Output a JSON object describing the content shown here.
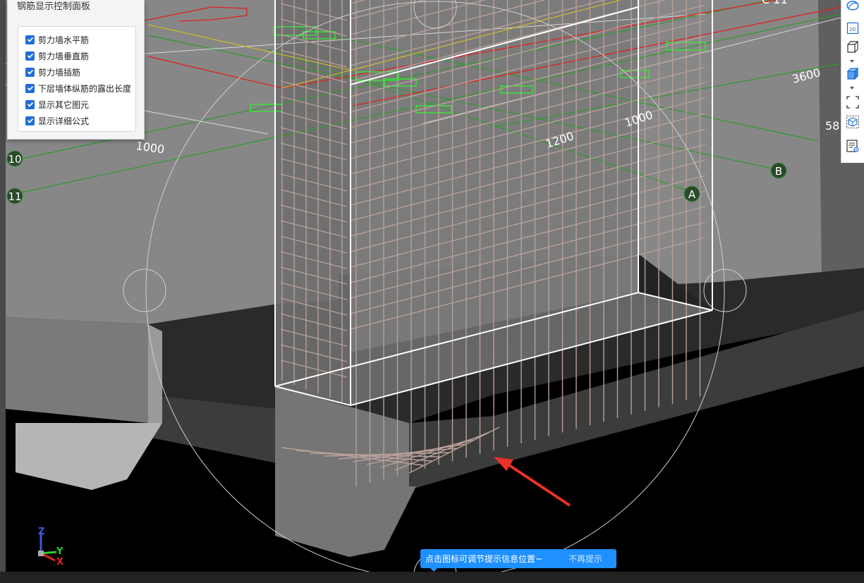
{
  "panel": {
    "title": "钢筋显示控制面板",
    "options": [
      {
        "label": "剪力墙水平筋",
        "checked": true
      },
      {
        "label": "剪力墙垂直筋",
        "checked": true
      },
      {
        "label": "剪力墙插筋",
        "checked": true
      },
      {
        "label": "下层墙体纵筋的露出长度",
        "checked": true
      },
      {
        "label": "显示其它图元",
        "checked": true
      },
      {
        "label": "显示详细公式",
        "checked": true
      }
    ]
  },
  "scene": {
    "dimensions": [
      "1000",
      "1200",
      "1000",
      "3600",
      "58",
      "1000"
    ],
    "grid_axes": [
      "10",
      "11",
      "A",
      "B"
    ],
    "top_partial_label": "C 11"
  },
  "axis_triad": {
    "z": "Z",
    "y": "Y",
    "x": "X"
  },
  "toolbar": {
    "items": [
      "orbit-icon",
      "2d-view-icon",
      "box-view-icon",
      "solid-view-icon",
      "fit-extent-icon",
      "isolate-icon",
      "list-settings-icon"
    ],
    "view_2d_label": "2D"
  },
  "tip": {
    "text": "点击图标可调节提示信息位置~",
    "dismiss": "不再提示"
  },
  "colors": {
    "accent": "#1e90ff",
    "checkbox": "#1f6fd8",
    "rebar": "#b8a09a",
    "grid_line": "#2e9a2e",
    "label_green": "#39e339",
    "red_line": "#e02020",
    "arrow": "#e8312a"
  }
}
